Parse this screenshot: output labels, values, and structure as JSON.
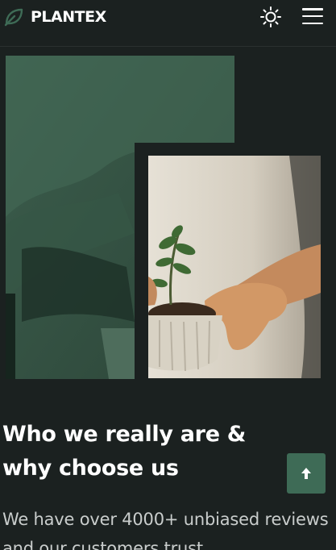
{
  "header": {
    "brand": "PLANTEX",
    "logo_icon": "leaf-icon",
    "theme_icon": "sun-icon",
    "menu_icon": "hamburger-menu-icon"
  },
  "hero_images": {
    "large_alt": "hands-holding-plant-green-overlay",
    "small_alt": "hands-holding-potted-plant"
  },
  "about": {
    "heading": "Who we really are & why choose us",
    "paragraph": "We have over 4000+ unbiased reviews and our customers trust"
  },
  "scroll_top": {
    "icon": "arrow-up-icon"
  },
  "colors": {
    "background": "#1b2120",
    "accent": "#3e6b56",
    "text": "#ffffff",
    "muted_text": "#c9cdcc"
  }
}
